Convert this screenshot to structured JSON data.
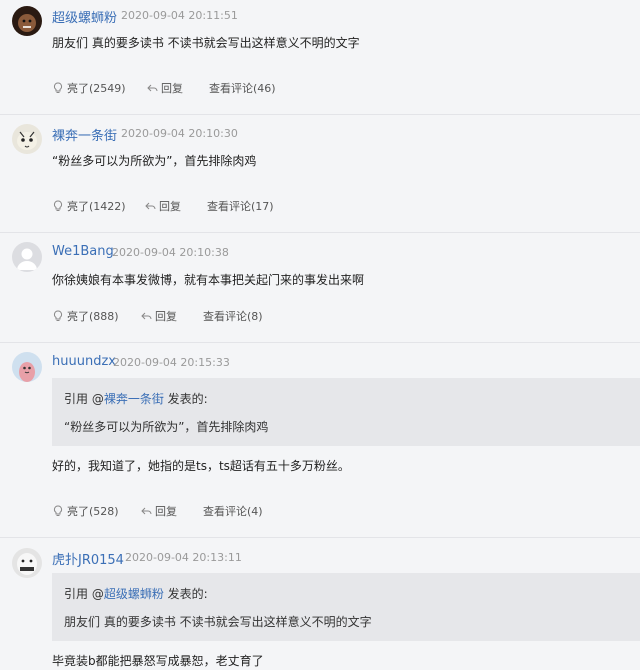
{
  "comments": [
    {
      "username": "超级螺蛳粉",
      "time": "2020-09-04 20:11:51",
      "content": "朋友们 真的要多读书 不读书就会写出这样意义不明的文字",
      "like_label": "亮了(2549)",
      "reply_label": "回复",
      "view_label": "查看评论(46)"
    },
    {
      "username": "裸奔一条街",
      "time": "2020-09-04 20:10:30",
      "content": "“粉丝多可以为所欲为”，首先排除肉鸡",
      "like_label": "亮了(1422)",
      "reply_label": "回复",
      "view_label": "查看评论(17)"
    },
    {
      "username": "We1Bang",
      "time": "2020-09-04 20:10:38",
      "content": "你徐姨娘有本事发微博，就有本事把关起门来的事发出来啊",
      "like_label": "亮了(888)",
      "reply_label": "回复",
      "view_label": "查看评论(8)"
    },
    {
      "username": "huuundzx",
      "time": "2020-09-04 20:15:33",
      "quote": {
        "prefix": "引用 @",
        "user": "裸奔一条街",
        "suffix": " 发表的:",
        "text": "“粉丝多可以为所欲为”，首先排除肉鸡"
      },
      "content": "好的，我知道了，她指的是ts，ts超话有五十多万粉丝。",
      "like_label": "亮了(528)",
      "reply_label": "回复",
      "view_label": "查看评论(4)"
    },
    {
      "username": "虎扑JR0154",
      "time": "2020-09-04 20:13:11",
      "quote": {
        "prefix": "引用 @",
        "user": "超级螺蛳粉",
        "suffix": " 发表的:",
        "text": "朋友们 真的要多读书 不读书就会写出这样意义不明的文字"
      },
      "content": "毕竟装b都能把暴怒写成暴恕，老丈育了"
    }
  ],
  "icons": {
    "like": "lightbulb-icon",
    "reply": "reply-arrow-icon"
  },
  "colors": {
    "username": "#3b6fb6",
    "background": "#f4f5f7",
    "quote_bg": "#e6e7ea"
  }
}
